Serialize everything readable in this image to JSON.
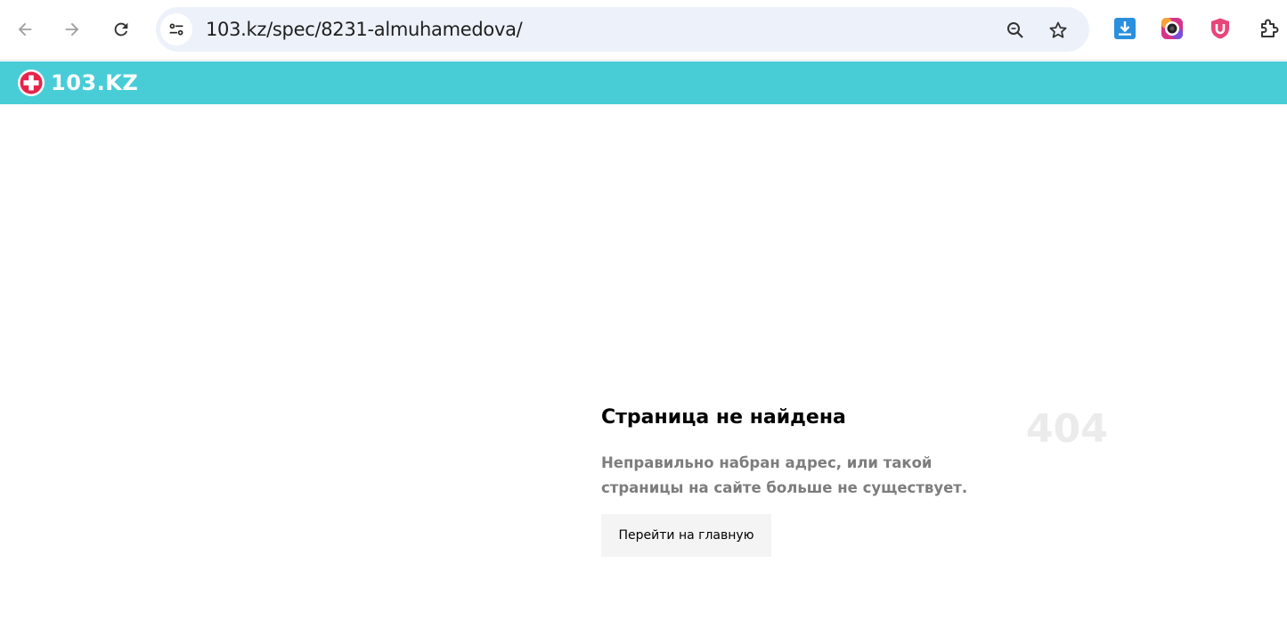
{
  "browser": {
    "url": "103.kz/spec/8231-almuhamedova/",
    "icons": [
      "back-icon",
      "forward-icon",
      "reload-icon",
      "site-info-icon",
      "zoom-icon",
      "bookmark-star-icon",
      "download-extension-icon",
      "camera-extension-icon",
      "shield-extension-icon",
      "extensions-puzzle-icon"
    ]
  },
  "site": {
    "logo_text": "103.KZ",
    "header_color": "#48cdd7",
    "logo_accent": "#e8234a"
  },
  "error": {
    "title": "Страница не найдена",
    "code": "404",
    "description": "Неправильно набран адрес, или такой страницы на сайте больше не существует.",
    "button_label": "Перейти на главную"
  }
}
